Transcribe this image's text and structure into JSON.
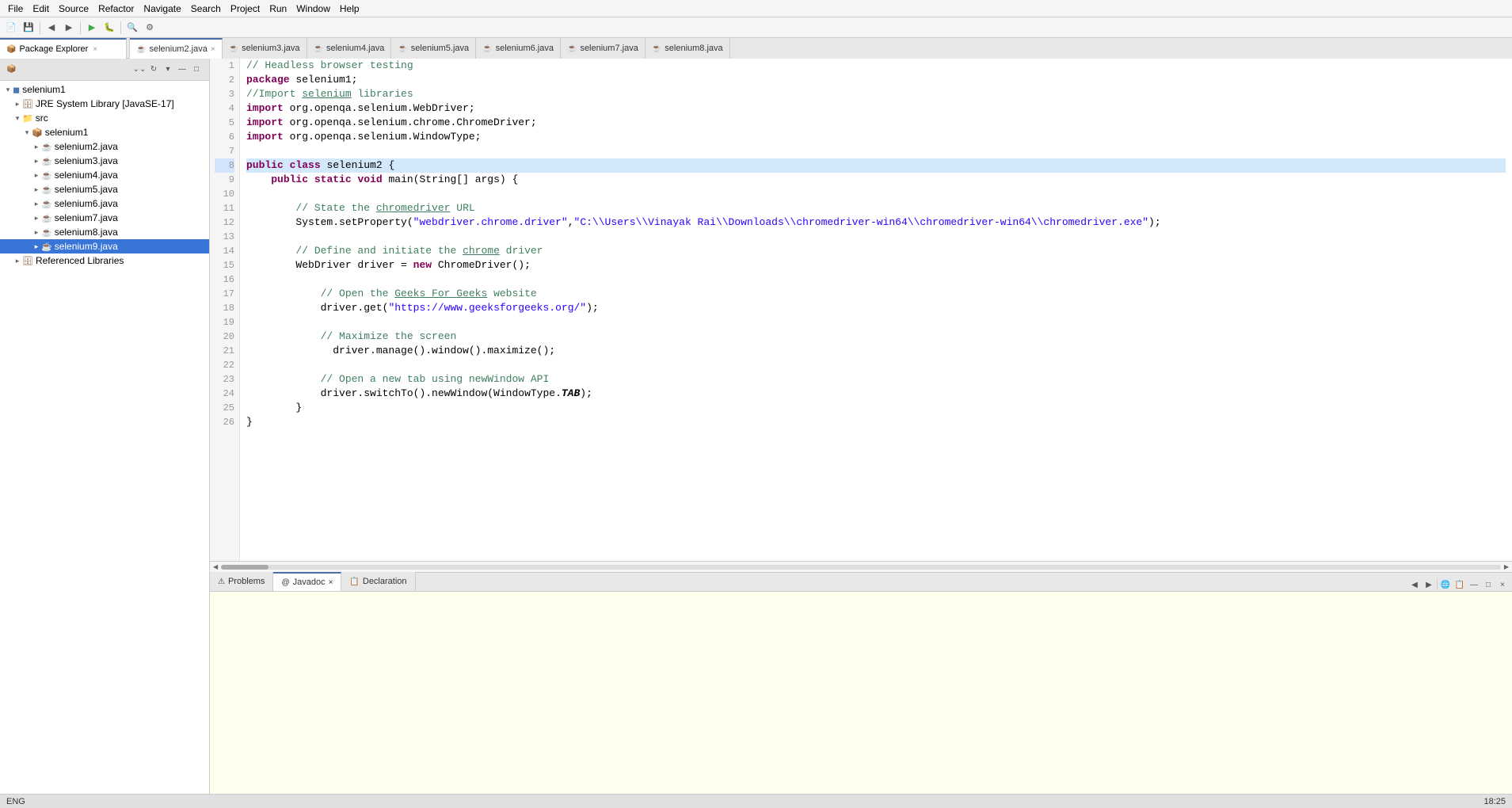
{
  "menubar": {
    "items": [
      "File",
      "Edit",
      "Source",
      "Refactor",
      "Navigate",
      "Search",
      "Project",
      "Run",
      "Window",
      "Help"
    ]
  },
  "panel": {
    "title": "Package Explorer",
    "close_label": "×"
  },
  "tree": {
    "items": [
      {
        "id": "selenium1",
        "label": "selenium1",
        "level": 0,
        "type": "project",
        "expanded": true,
        "toggle": "▾"
      },
      {
        "id": "jre",
        "label": "JRE System Library [JavaSE-17]",
        "level": 1,
        "type": "library",
        "expanded": false,
        "toggle": "▸"
      },
      {
        "id": "src",
        "label": "src",
        "level": 1,
        "type": "folder",
        "expanded": true,
        "toggle": "▾"
      },
      {
        "id": "selenium1pkg",
        "label": "selenium1",
        "level": 2,
        "type": "package",
        "expanded": true,
        "toggle": "▾"
      },
      {
        "id": "selenium2java",
        "label": "selenium2.java",
        "level": 3,
        "type": "java",
        "expanded": false,
        "toggle": "▸"
      },
      {
        "id": "selenium3java",
        "label": "selenium3.java",
        "level": 3,
        "type": "java",
        "expanded": false,
        "toggle": "▸"
      },
      {
        "id": "selenium4java",
        "label": "selenium4.java",
        "level": 3,
        "type": "java",
        "expanded": false,
        "toggle": "▸"
      },
      {
        "id": "selenium5java",
        "label": "selenium5.java",
        "level": 3,
        "type": "java",
        "expanded": false,
        "toggle": "▸"
      },
      {
        "id": "selenium6java",
        "label": "selenium6.java",
        "level": 3,
        "type": "java",
        "expanded": false,
        "toggle": "▸"
      },
      {
        "id": "selenium7java",
        "label": "selenium7.java",
        "level": 3,
        "type": "java",
        "expanded": false,
        "toggle": "▸"
      },
      {
        "id": "selenium8java",
        "label": "selenium8.java",
        "level": 3,
        "type": "java",
        "expanded": false,
        "toggle": "▸"
      },
      {
        "id": "selenium9java",
        "label": "selenium9.java",
        "level": 3,
        "type": "java",
        "selected": true,
        "expanded": false,
        "toggle": "▸"
      },
      {
        "id": "reflibs",
        "label": "Referenced Libraries",
        "level": 1,
        "type": "library",
        "expanded": false,
        "toggle": "▸"
      }
    ]
  },
  "editor": {
    "tabs": [
      {
        "id": "selenium2",
        "label": "selenium2.java",
        "active": true,
        "closeable": true
      },
      {
        "id": "selenium3",
        "label": "selenium3.java",
        "active": false,
        "closeable": false
      },
      {
        "id": "selenium4",
        "label": "selenium4.java",
        "active": false,
        "closeable": false
      },
      {
        "id": "selenium5",
        "label": "selenium5.java",
        "active": false,
        "closeable": false
      },
      {
        "id": "selenium6",
        "label": "selenium6.java",
        "active": false,
        "closeable": false
      },
      {
        "id": "selenium7",
        "label": "selenium7.java",
        "active": false,
        "closeable": false
      },
      {
        "id": "selenium8",
        "label": "selenium8.java",
        "active": false,
        "closeable": false
      }
    ]
  },
  "bottom_panel": {
    "tabs": [
      {
        "id": "problems",
        "label": "Problems",
        "active": false,
        "closeable": false
      },
      {
        "id": "javadoc",
        "label": "Javadoc",
        "active": true,
        "closeable": true
      },
      {
        "id": "declaration",
        "label": "Declaration",
        "active": false,
        "closeable": false
      }
    ]
  },
  "status": {
    "encoding": "ENG",
    "time": "18:25"
  },
  "code_lines": [
    {
      "num": 1,
      "content": "// Headless browser testing",
      "type": "comment"
    },
    {
      "num": 2,
      "content": "package selenium1;",
      "type": "code"
    },
    {
      "num": 3,
      "content": "//Import selenium libraries",
      "type": "comment_underline"
    },
    {
      "num": 4,
      "content": "import org.openqa.selenium.WebDriver;",
      "type": "import"
    },
    {
      "num": 5,
      "content": "import org.openqa.selenium.chrome.ChromeDriver;",
      "type": "import"
    },
    {
      "num": 6,
      "content": "import org.openqa.selenium.WindowType;",
      "type": "import"
    },
    {
      "num": 7,
      "content": "",
      "type": "empty"
    },
    {
      "num": 8,
      "content": "public class selenium2 {",
      "type": "class",
      "highlight": true
    },
    {
      "num": 9,
      "content": "    public static void main(String[] args) {",
      "type": "code"
    },
    {
      "num": 10,
      "content": "",
      "type": "empty"
    },
    {
      "num": 11,
      "content": "        // State the chromedriver URL",
      "type": "comment_underline2"
    },
    {
      "num": 12,
      "content": "        System.setProperty(\"webdriver.chrome.driver\",\"C:\\\\Users\\\\Vinayak Rai\\\\Downloads\\\\chromedriver-win64\\\\chromedriver-win64\\\\chromedriver.exe\");",
      "type": "code"
    },
    {
      "num": 13,
      "content": "",
      "type": "empty"
    },
    {
      "num": 14,
      "content": "        // Define and initiate the chrome driver",
      "type": "comment_underline3"
    },
    {
      "num": 15,
      "content": "        WebDriver driver = new ChromeDriver();",
      "type": "code"
    },
    {
      "num": 16,
      "content": "",
      "type": "empty"
    },
    {
      "num": 17,
      "content": "            // Open the Geeks For Geeks website",
      "type": "comment_underline4"
    },
    {
      "num": 18,
      "content": "            driver.get(\"https://www.geeksforgeeks.org/\");",
      "type": "code_str"
    },
    {
      "num": 19,
      "content": "",
      "type": "empty"
    },
    {
      "num": 20,
      "content": "            // Maximize the screen",
      "type": "comment"
    },
    {
      "num": 21,
      "content": "              driver.manage().window().maximize();",
      "type": "code"
    },
    {
      "num": 22,
      "content": "",
      "type": "empty"
    },
    {
      "num": 23,
      "content": "            // Open a new tab using newWindow API",
      "type": "comment"
    },
    {
      "num": 24,
      "content": "            driver.switchTo().newWindow(WindowType.TAB);",
      "type": "code_tab"
    },
    {
      "num": 25,
      "content": "        }",
      "type": "code"
    },
    {
      "num": 26,
      "content": "}",
      "type": "code"
    }
  ]
}
